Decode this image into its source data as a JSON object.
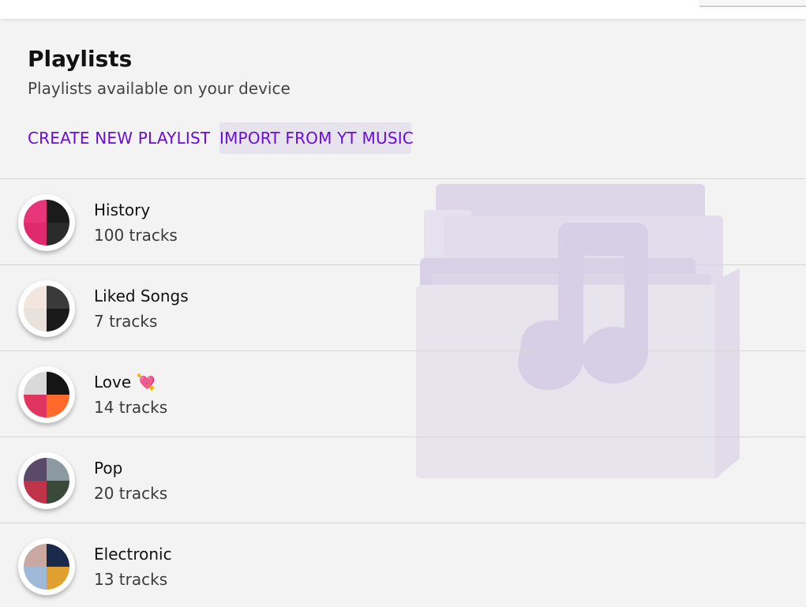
{
  "header": {
    "title": "Playlists",
    "subtitle": "Playlists available on your device"
  },
  "actions": {
    "create_label": "CREATE NEW PLAYLIST",
    "import_label": "IMPORT FROM YT MUSIC"
  },
  "background_icon": "music-folder-icon",
  "colors": {
    "accent": "#6a0dd8",
    "background": "#f3f3f3",
    "folder_tint": "#ddd6ea"
  },
  "playlists": [
    {
      "title": "History",
      "subtitle": "100 tracks",
      "thumb_colors": [
        "#e8357a",
        "#1b1b1b",
        "#e02a6e",
        "#2a2a2a"
      ]
    },
    {
      "title": "Liked Songs",
      "subtitle": "7 tracks",
      "thumb_colors": [
        "#f2e6de",
        "#3a3a3a",
        "#e9e2dc",
        "#1a1a1a"
      ]
    },
    {
      "title": "Love 💘",
      "subtitle": "14 tracks",
      "thumb_colors": [
        "#d9d9d9",
        "#151515",
        "#e0355f",
        "#ff6a2a"
      ]
    },
    {
      "title": "Pop",
      "subtitle": "20 tracks",
      "thumb_colors": [
        "#5a4a6a",
        "#8a9aa0",
        "#c0344a",
        "#3a4a3a"
      ]
    },
    {
      "title": "Electronic",
      "subtitle": "13 tracks",
      "thumb_colors": [
        "#c8a8a0",
        "#1a2a4a",
        "#a0b8d8",
        "#e0a030"
      ]
    }
  ]
}
